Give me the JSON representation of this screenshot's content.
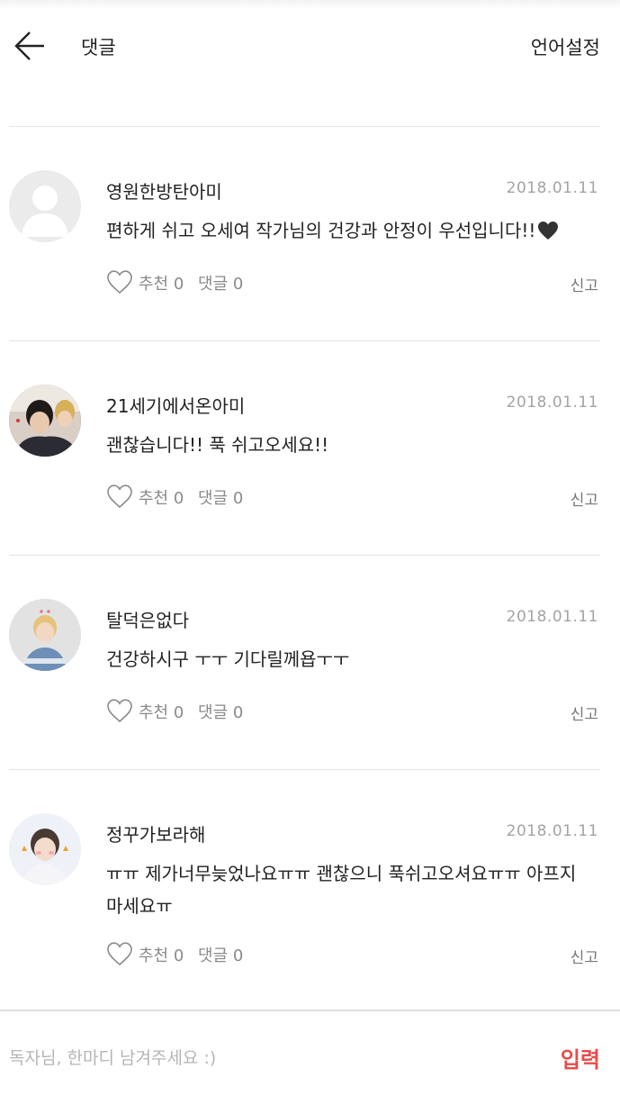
{
  "header": {
    "title": "댓글",
    "language_settings_label": "언어설정"
  },
  "comments": [
    {
      "author": "영원한방탄아미",
      "date": "2018.01.11",
      "text": "편하게 쉬고 오세여 작가님의 건강과 안정이 우선입니다!!",
      "emoji": "🖤",
      "like_label": "추천",
      "likes": "0",
      "reply_label": "댓글",
      "replies": "0",
      "report_label": "신고",
      "avatar": "default-avatar"
    },
    {
      "author": "21세기에서온아미",
      "date": "2018.01.11",
      "text": "괜찮습니다!! 푹 쉬고오세요!!",
      "like_label": "추천",
      "likes": "0",
      "reply_label": "댓글",
      "replies": "0",
      "report_label": "신고",
      "avatar": "photo-avatar"
    },
    {
      "author": "탈덕은없다",
      "date": "2018.01.11",
      "text": "건강하시구 ㅜㅜ 기다릴께욥ㅜㅜ",
      "like_label": "추천",
      "likes": "0",
      "reply_label": "댓글",
      "replies": "0",
      "report_label": "신고",
      "avatar": "photo-avatar"
    },
    {
      "author": "정꾸가보라해",
      "date": "2018.01.11",
      "text": "ㅠㅠ 제가너무늦었나요ㅠㅠ 괜찮으니 푹쉬고오셔요ㅠㅠ 아프지 마세요ㅠ",
      "like_label": "추천",
      "likes": "0",
      "reply_label": "댓글",
      "replies": "0",
      "report_label": "신고",
      "avatar": "photo-avatar"
    }
  ],
  "input": {
    "placeholder": "독자님, 한마디 남겨주세요 :)",
    "value": "",
    "submit_label": "입력"
  },
  "colors": {
    "accent": "#e84b4b",
    "date": "#a3a3a3",
    "divider": "#e4e4e4"
  },
  "icons": [
    "back-arrow-icon",
    "heart-outline-icon",
    "black-heart-emoji"
  ]
}
